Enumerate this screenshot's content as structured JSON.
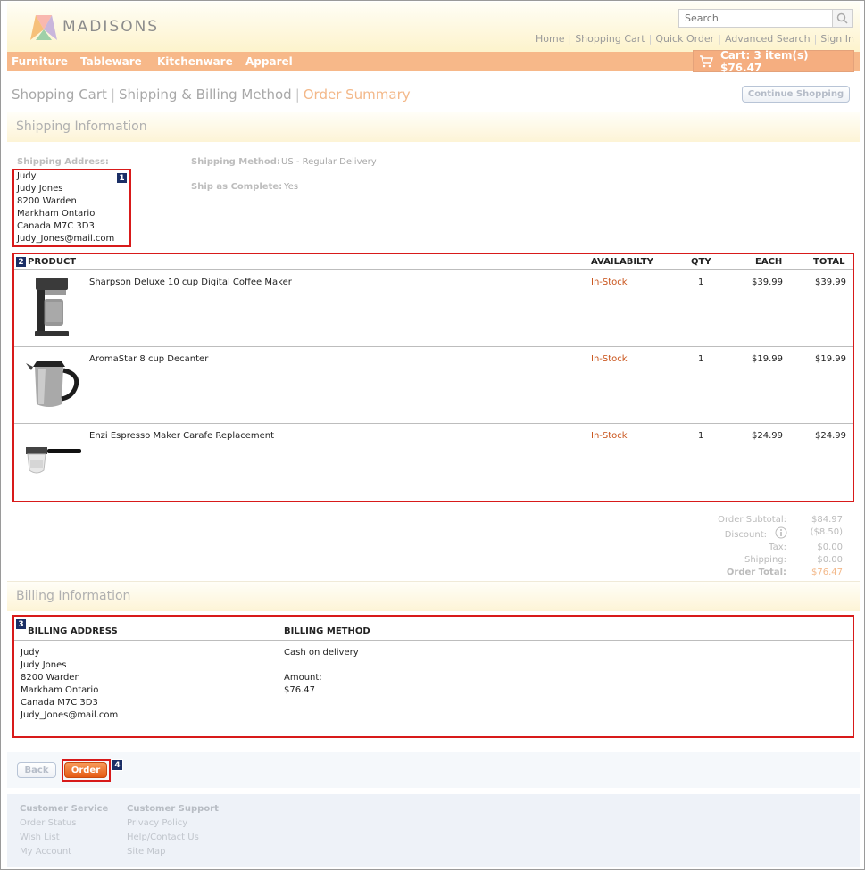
{
  "header": {
    "logo_text": "MADISONS",
    "search_placeholder": "Search",
    "top_links": [
      "Home",
      "Shopping Cart",
      "Quick Order",
      "Advanced Search",
      "Sign In"
    ]
  },
  "nav": {
    "items": [
      "Furniture",
      "Tableware",
      "Kitchenware",
      "Apparel"
    ],
    "cart_label": "Cart: 3 item(s) $76.47"
  },
  "breadcrumb": {
    "steps": [
      "Shopping Cart",
      "Shipping & Billing Method",
      "Order Summary"
    ],
    "continue_label": "Continue Shopping"
  },
  "shipping": {
    "section_title": "Shipping Information",
    "address_label": "Shipping Address:",
    "address_lines": [
      "Judy",
      "Judy Jones",
      "8200 Warden",
      "Markham Ontario",
      "Canada M7C 3D3",
      "Judy_Jones@mail.com"
    ],
    "method_label": "Shipping Method:",
    "method_value": "US - Regular Delivery",
    "complete_label": "Ship as Complete:",
    "complete_value": "Yes"
  },
  "products": {
    "headers": {
      "product": "PRODUCT",
      "availability": "AVAILABILTY",
      "qty": "QTY",
      "each": "EACH",
      "total": "TOTAL"
    },
    "rows": [
      {
        "name": "Sharpson Deluxe 10 cup Digital Coffee Maker",
        "availability": "In-Stock",
        "qty": "1",
        "each": "$39.99",
        "total": "$39.99"
      },
      {
        "name": "AromaStar 8 cup Decanter",
        "availability": "In-Stock",
        "qty": "1",
        "each": "$19.99",
        "total": "$19.99"
      },
      {
        "name": "Enzi Espresso Maker Carafe Replacement",
        "availability": "In-Stock",
        "qty": "1",
        "each": "$24.99",
        "total": "$24.99"
      }
    ]
  },
  "summary": {
    "subtotal_label": "Order Subtotal:",
    "subtotal": "$84.97",
    "discount_label": "Discount:",
    "discount": "($8.50)",
    "tax_label": "Tax:",
    "tax": "$0.00",
    "shipping_label": "Shipping:",
    "shipping": "$0.00",
    "total_label": "Order Total:",
    "total": "$76.47"
  },
  "billing": {
    "section_title": "Billing Information",
    "address_header": "BILLING ADDRESS",
    "method_header": "BILLING METHOD",
    "address_lines": [
      "Judy",
      "Judy Jones",
      "8200 Warden",
      "Markham Ontario",
      "Canada M7C 3D3",
      "Judy_Jones@mail.com"
    ],
    "method_value": "Cash on delivery",
    "amount_label": "Amount:",
    "amount_value": "$76.47"
  },
  "actions": {
    "back_label": "Back",
    "order_label": "Order"
  },
  "annotations": [
    "1",
    "2",
    "3",
    "4"
  ],
  "footer": {
    "col1_title": "Customer Service",
    "col1_links": [
      "Order Status",
      "Wish List",
      "My Account"
    ],
    "col2_title": "Customer Support",
    "col2_links": [
      "Privacy Policy",
      "Help/Contact Us",
      "Site Map"
    ]
  },
  "colors": {
    "accent_orange": "#f7b889",
    "stock_orange": "#c9531a",
    "annotation_red": "#d81a1a",
    "badge_navy": "#1b2f66"
  }
}
